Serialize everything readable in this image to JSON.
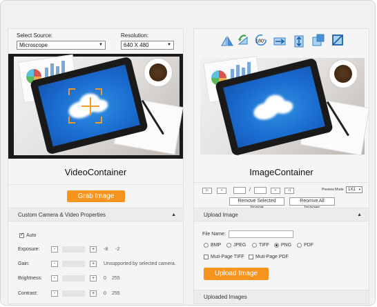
{
  "left": {
    "select_source_label": "Select Source:",
    "source_value": "Microscope",
    "resolution_label": "Resolution:",
    "resolution_value": "640 X 480",
    "video_title": "VideoContainer",
    "grab_button": "Grab Image",
    "camera_section": "Custom Camera & Video Properties",
    "auto_label": "Auto",
    "auto_checked": true,
    "rows": [
      {
        "label": "Exposure:",
        "minus": "-",
        "plus": "+",
        "min": "-8",
        "max": "-2",
        "note": ""
      },
      {
        "label": "Gain:",
        "minus": "-",
        "plus": "+",
        "min": "",
        "max": "",
        "note": "Unsupported by selected camera."
      },
      {
        "label": "Brightness:",
        "minus": "-",
        "plus": "+",
        "min": "0",
        "max": "255",
        "note": ""
      },
      {
        "label": "Contrast:",
        "minus": "-",
        "plus": "+",
        "min": "0",
        "max": "255",
        "note": ""
      }
    ]
  },
  "right": {
    "toolbar_icons": [
      "flip-horizontal-icon",
      "rotate-left-icon",
      "rotate-180-icon",
      "mirror-icon",
      "flip-vertical-icon",
      "resize-icon",
      "crop-icon"
    ],
    "rotate_180_label": "180°",
    "image_title": "ImageContainer",
    "nav": {
      "first": "|«",
      "prev": "«",
      "separator": "/",
      "next": "»",
      "last": "»|"
    },
    "preview_mode_label": "Preview Mode",
    "preview_mode_value": "1X1",
    "remove_selected": "Remove Selected Image",
    "remove_all": "Reomve All Images",
    "upload_section": "Upload Image",
    "file_name_label": "File Name:",
    "formats": [
      {
        "label": "BMP",
        "checked": false
      },
      {
        "label": "JPEG",
        "checked": false
      },
      {
        "label": "TIFF",
        "checked": false
      },
      {
        "label": "PNG",
        "checked": true
      },
      {
        "label": "PDF",
        "checked": false
      }
    ],
    "multipage": [
      {
        "label": "Muti-Page TIFF",
        "checked": false
      },
      {
        "label": "Muti-Page PDF",
        "checked": false
      }
    ],
    "upload_button": "Upload Image",
    "uploaded_images": "Uploaded Images"
  },
  "colors": {
    "accent": "#f7941d",
    "toolbar_blue": "#4a90d9"
  }
}
